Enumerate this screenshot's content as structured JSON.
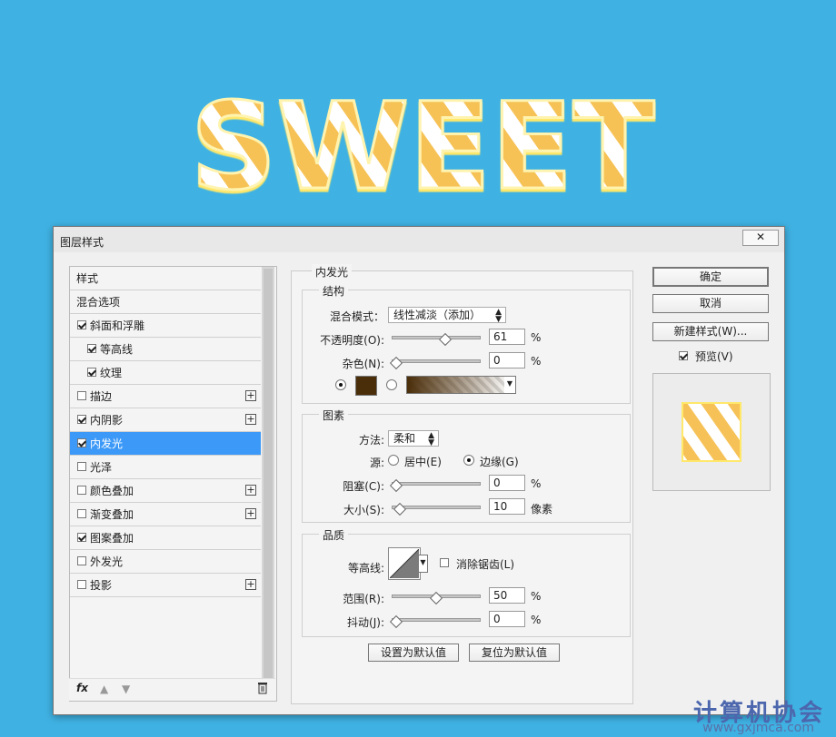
{
  "window": {
    "title": "图层样式"
  },
  "hero_text": "SWEET",
  "sidebar": {
    "items": [
      {
        "label": "样式",
        "checked": false,
        "has_plus": false,
        "indent": 0,
        "active": false
      },
      {
        "label": "混合选项",
        "checked": false,
        "has_plus": false,
        "indent": 0,
        "active": false
      },
      {
        "label": "斜面和浮雕",
        "checked": true,
        "has_plus": false,
        "indent": 0,
        "active": false
      },
      {
        "label": "等高线",
        "checked": true,
        "has_plus": false,
        "indent": 1,
        "active": false
      },
      {
        "label": "纹理",
        "checked": true,
        "has_plus": false,
        "indent": 1,
        "active": false
      },
      {
        "label": "描边",
        "checked": false,
        "has_plus": true,
        "indent": 0,
        "active": false
      },
      {
        "label": "内阴影",
        "checked": true,
        "has_plus": true,
        "indent": 0,
        "active": false
      },
      {
        "label": "内发光",
        "checked": true,
        "has_plus": false,
        "indent": 0,
        "active": true
      },
      {
        "label": "光泽",
        "checked": false,
        "has_plus": false,
        "indent": 0,
        "active": false
      },
      {
        "label": "颜色叠加",
        "checked": false,
        "has_plus": true,
        "indent": 0,
        "active": false
      },
      {
        "label": "渐变叠加",
        "checked": false,
        "has_plus": true,
        "indent": 0,
        "active": false
      },
      {
        "label": "图案叠加",
        "checked": true,
        "has_plus": false,
        "indent": 0,
        "active": false
      },
      {
        "label": "外发光",
        "checked": false,
        "has_plus": false,
        "indent": 0,
        "active": false
      },
      {
        "label": "投影",
        "checked": false,
        "has_plus": true,
        "indent": 0,
        "active": false
      }
    ],
    "fx_label": "fx"
  },
  "main": {
    "panel_title": "内发光",
    "structure": {
      "title": "结构",
      "blend_mode_label": "混合模式：",
      "blend_mode_value": "线性减淡（添加）",
      "opacity_label": "不透明度(O):",
      "opacity_value": "61",
      "opacity_level": 0.61,
      "noise_label": "杂色(N):",
      "noise_value": "0",
      "noise_level": 0,
      "percent": "%",
      "glow_color": "#4a2d09"
    },
    "elements": {
      "title": "图素",
      "method_label": "方法:",
      "method_value": "柔和",
      "source_label": "源:",
      "source_center": "居中(E)",
      "source_edge": "边缘(G)",
      "choke_label": "阻塞(C):",
      "choke_value": "0",
      "choke_level": 0,
      "size_label": "大小(S):",
      "size_value": "10",
      "size_level": 0.04,
      "size_unit": "像素"
    },
    "quality": {
      "title": "品质",
      "contour_label": "等高线:",
      "anti_alias_label": "消除锯齿(L)",
      "range_label": "范围(R):",
      "range_value": "50",
      "range_level": 0.5,
      "jitter_label": "抖动(J):",
      "jitter_value": "0",
      "jitter_level": 0
    },
    "buttons": {
      "make_default": "设置为默认值",
      "reset_default": "复位为默认值"
    }
  },
  "right": {
    "ok": "确定",
    "cancel": "取消",
    "new_style": "新建样式(W)...",
    "preview_label": "预览(V)"
  },
  "watermark": {
    "line1": "计算机协会",
    "line2": "www.gxjmca.com"
  },
  "colors": {
    "background": "#3fb2e3",
    "selection": "#3c99f7",
    "hero_orange": "#f6c257",
    "hero_yellow": "#ffe86a"
  }
}
